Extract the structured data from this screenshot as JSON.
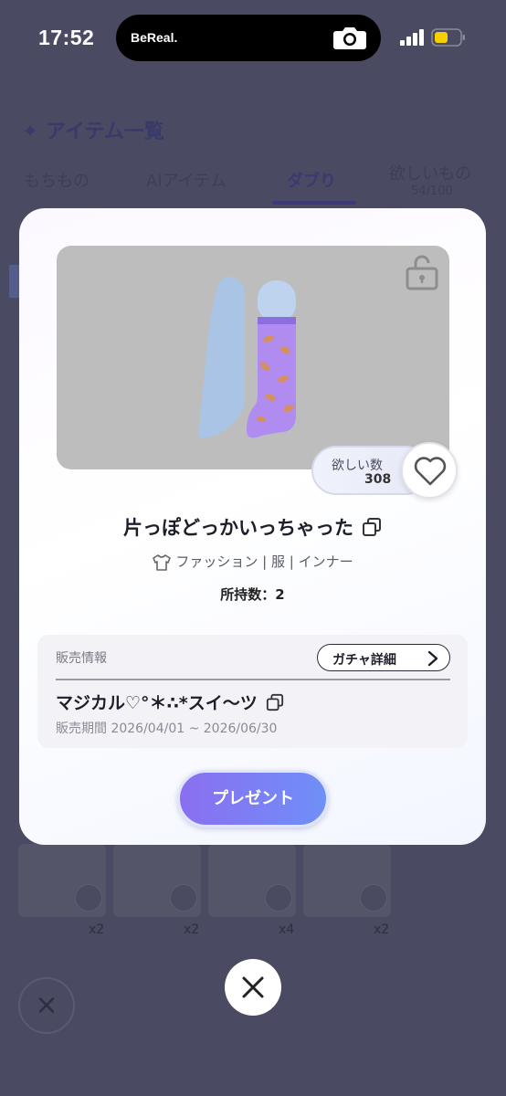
{
  "status_bar": {
    "time": "17:52",
    "island_label": "BeReal.",
    "battery_color": "#f5d000"
  },
  "background_page": {
    "title": "✦ アイテム一覧",
    "tabs": [
      {
        "label": "もちもの"
      },
      {
        "label": "AIアイテム"
      },
      {
        "label": "ダブり"
      },
      {
        "label": "欲しいもの",
        "count": "54/100"
      }
    ],
    "grid_counts": [
      "x2",
      "x2",
      "x4",
      "x2"
    ],
    "close_symbol": "×"
  },
  "modal": {
    "wish": {
      "label": "欲しい数",
      "count": "308"
    },
    "item_name": "片っぽどっかいっちゃった",
    "category": "ファッション | 服 | インナー",
    "owned": "所持数：2",
    "sale_info": {
      "heading": "販売情報",
      "gacha_button_label": "ガチャ詳細",
      "gacha_name": "マジカル♡°＊∴*スイ〜ツ",
      "period": "販売期間 2026/04/01 ~ 2026/06/30"
    },
    "present_button_label": "プレゼント"
  },
  "colors": {
    "overlay": "#4a4a62",
    "accent_gradient_start": "#8a6ff0",
    "accent_gradient_end": "#6f8ff7",
    "preview_bg": "#bdbdbd"
  }
}
